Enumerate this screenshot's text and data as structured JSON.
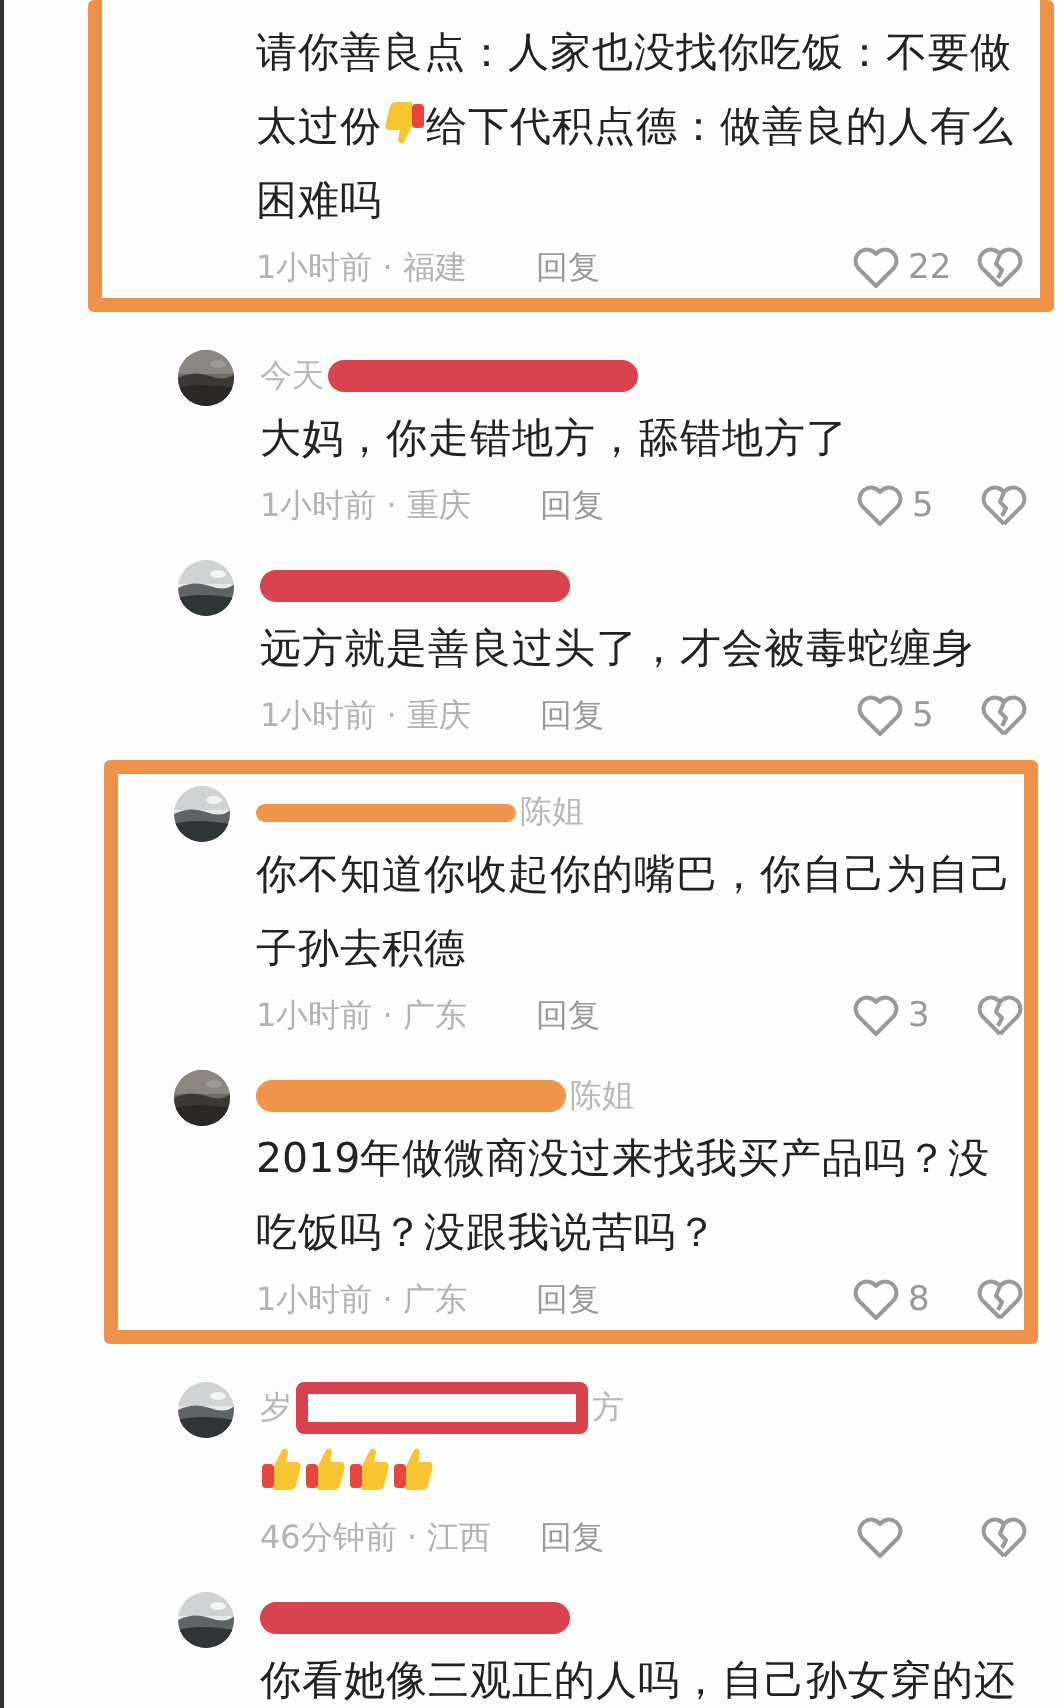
{
  "groups": [
    {
      "highlighted": true,
      "comments": [
        {
          "body": [
            {
              "kind": "line",
              "text": "请你善良点：人家也没找你吃饭：不要做"
            },
            {
              "kind": "text",
              "text": "太过份"
            },
            {
              "kind": "thumbs_down"
            },
            {
              "kind": "text",
              "text": "给下代积点德：做善良的人有么"
            },
            {
              "kind": "line",
              "text": "困难吗"
            }
          ],
          "time": "1小时前 · 福建",
          "reply": "回复",
          "likes": "22"
        }
      ]
    },
    {
      "highlighted": false,
      "comments": [
        {
          "name_start": "今天",
          "redaction": {
            "kind": "bar",
            "color": "#d8434f"
          },
          "body": [
            {
              "kind": "text",
              "text": "大妈，你走错地方，舔错地方了"
            }
          ],
          "time": "1小时前 · 重庆",
          "reply": "回复",
          "likes": "5"
        },
        {
          "redaction": {
            "kind": "bar",
            "color": "#d8434f"
          },
          "body": [
            {
              "kind": "text",
              "text": "远方就是善良过头了，才会被毒蛇缠身"
            }
          ],
          "time": "1小时前 · 重庆",
          "reply": "回复",
          "likes": "5"
        }
      ]
    },
    {
      "highlighted": true,
      "comments": [
        {
          "redaction": {
            "kind": "line",
            "color": "#f0964c"
          },
          "name_end": "陈姐",
          "body": [
            {
              "kind": "text",
              "text": "你不知道你收起你的嘴巴，你自己为自己子孙去积德"
            }
          ],
          "time": "1小时前 · 广东",
          "reply": "回复",
          "likes": "3"
        },
        {
          "redaction": {
            "kind": "bar",
            "color": "#f0964c"
          },
          "name_end": "陈姐",
          "body": [
            {
              "kind": "text",
              "text": "2019年做微商没过来找我买产品吗？没吃饭吗？没跟我说苦吗？"
            }
          ],
          "time": "1小时前 · 广东",
          "reply": "回复",
          "likes": "8"
        }
      ]
    },
    {
      "highlighted": false,
      "comments": [
        {
          "name_start": "岁",
          "redaction": {
            "kind": "frame",
            "color": "#d8434f"
          },
          "name_end": "方",
          "body": [
            {
              "kind": "thumbs_up"
            },
            {
              "kind": "thumbs_up"
            },
            {
              "kind": "thumbs_up"
            },
            {
              "kind": "thumbs_up"
            }
          ],
          "time": "46分钟前 · 江西",
          "reply": "回复"
        },
        {
          "redaction": {
            "kind": "bar",
            "color": "#d8434f"
          },
          "body": [
            {
              "kind": "text",
              "text": "你看她像三观正的人吗，自己孙女穿的还"
            }
          ]
        }
      ]
    }
  ]
}
